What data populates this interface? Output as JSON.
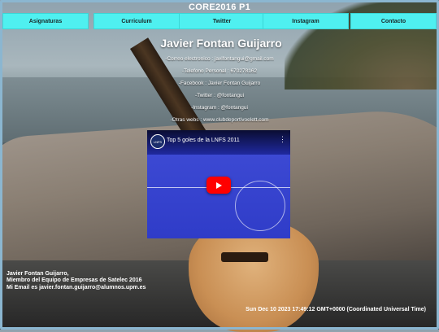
{
  "page": {
    "title": "CORE2016 P1"
  },
  "nav": {
    "items": [
      {
        "label": "Asignaturas"
      },
      {
        "label": "Curriculum"
      },
      {
        "label": "Twitter"
      },
      {
        "label": "Instagram"
      },
      {
        "label": "Contacto"
      }
    ],
    "color": "#4ff0f0"
  },
  "profile": {
    "name": "Javier Fontan Guijarro",
    "email": "-Correo electronico : javifontangui@gmail.com",
    "phone": "-Telefono Personal : 670278162",
    "facebook": "-Facebook : Javier Fontan Guijarro",
    "twitter": "-Twitter : @fontangui",
    "instagram": "-Instagram : @fontangui",
    "webs": "-Otras webs : www.clubdeportivoelett.com"
  },
  "video": {
    "title": "Top 5 goles de la LNFS 2011",
    "channel_logo": "LNFS",
    "play_icon": "play-icon",
    "menu_icon": "more-vert-icon",
    "brand_color": "#ff0000"
  },
  "footer": {
    "line1": "Javier Fontan Guijarro,",
    "line2": "Miembro del Equipo de Empresas de Satelec 2016",
    "line3": "Mi Email es javier.fontan.guijarro@alumnos.upm.es",
    "datetime": "Sun Dec 10 2023 17:49:12 GMT+0000 (Coordinated Universal Time)"
  }
}
